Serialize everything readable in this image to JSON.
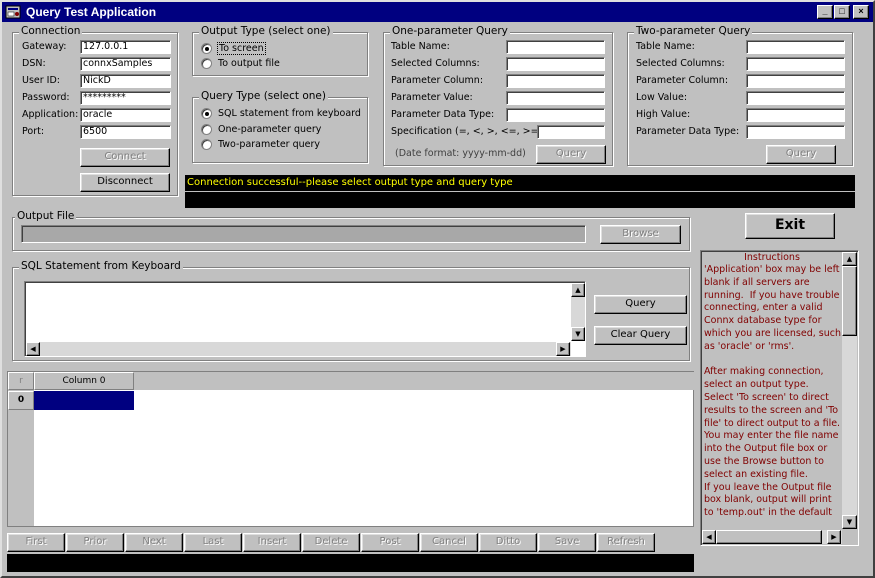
{
  "window": {
    "title": "Query Test Application",
    "minimize": "_",
    "maximize": "□",
    "close": "×"
  },
  "connection": {
    "legend": "Connection",
    "fields": [
      {
        "label": "Gateway:",
        "value": "127.0.0.1"
      },
      {
        "label": "DSN:",
        "value": "connxSamples"
      },
      {
        "label": "User ID:",
        "value": "NickD"
      },
      {
        "label": "Password:",
        "value": "*********"
      },
      {
        "label": "Application:",
        "value": "oracle"
      },
      {
        "label": "Port:",
        "value": "6500"
      }
    ],
    "connect_label": "Connect",
    "disconnect_label": "Disconnect"
  },
  "output_type": {
    "legend": "Output Type (select one)",
    "options": [
      "To screen",
      "To output file"
    ],
    "selected": 0
  },
  "query_type": {
    "legend": "Query Type (select one)",
    "options": [
      "SQL statement from keyboard",
      "One-parameter query",
      "Two-parameter query"
    ],
    "selected": 0
  },
  "one_param": {
    "legend": "One-parameter Query",
    "fields": [
      "Table Name:",
      "Selected Columns:",
      "Parameter Column:",
      "Parameter Value:",
      "Parameter Data Type:",
      "Specification (=, <, >, <=, >=):"
    ],
    "date_note": "(Date format:  yyyy-mm-dd)",
    "query_label": "Query"
  },
  "two_param": {
    "legend": "Two-parameter Query",
    "fields": [
      "Table Name:",
      "Selected Columns:",
      "Parameter Column:",
      "Low Value:",
      "High Value:",
      "Parameter Data Type:"
    ],
    "query_label": "Query"
  },
  "status": {
    "message": "Connection successful--please select output type and query type",
    "message2": ""
  },
  "output_file": {
    "legend": "Output File",
    "value": "",
    "browse_label": "Browse"
  },
  "exit_label": "Exit",
  "sql": {
    "legend": "SQL Statement from Keyboard",
    "text": "",
    "query_label": "Query",
    "clear_label": "Clear Query"
  },
  "grid": {
    "corner": "r",
    "columns": [
      "Column 0"
    ],
    "rows": [
      "0"
    ]
  },
  "nav_buttons": [
    "First",
    "Prior",
    "Next",
    "Last",
    "Insert",
    "Delete",
    "Post",
    "Cancel",
    "Ditto",
    "Save",
    "Refresh"
  ],
  "instructions": {
    "title": "Instructions",
    "body": "'Application' box may be left blank if all servers are running.  If you have trouble connecting, enter a valid Connx database type for which you are licensed, such as 'oracle' or 'rms'.\n\nAfter making connection, select an output type.\nSelect 'To screen' to direct results to the screen and 'To file' to direct output to a file.  You may enter the file name into the Output file box or use the Browse button to select an existing file.\nIf you leave the Output file box blank, output will print to 'temp.out' in the default"
  },
  "colors": {
    "title_bar": "#000080",
    "status_bg": "#000000",
    "status_text": "#ffff00",
    "instructions_text": "#800000",
    "selected_cell": "#000080"
  }
}
